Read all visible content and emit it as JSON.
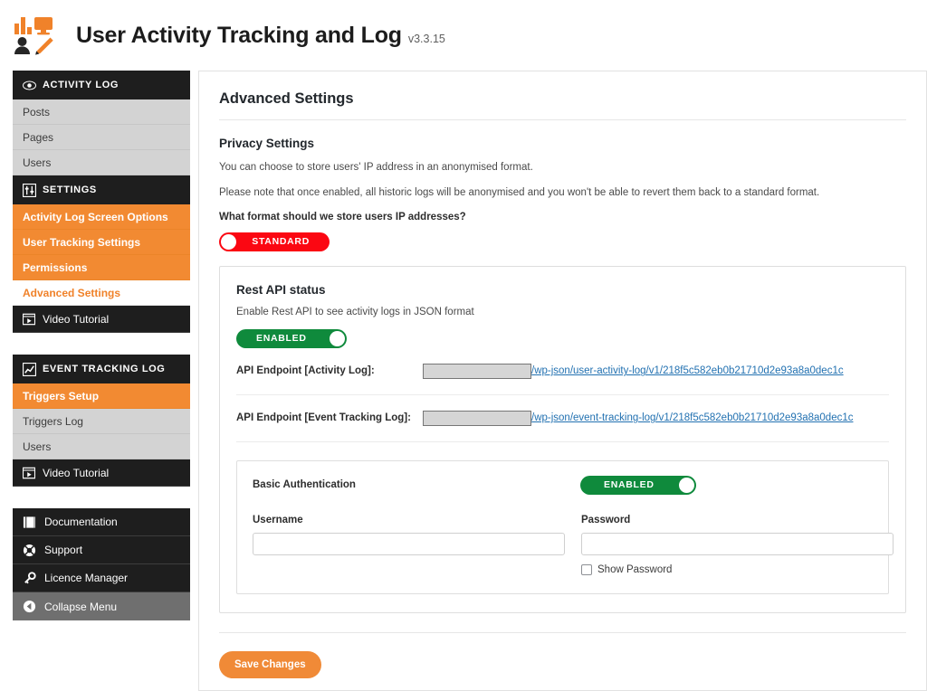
{
  "header": {
    "title": "User Activity Tracking and Log",
    "version": "v3.3.15",
    "logo_icon": "activity-tracking-logo-icon"
  },
  "sidebar": {
    "groups": [
      {
        "head": {
          "label": "ACTIVITY LOG",
          "icon": "eye-icon"
        },
        "items": [
          {
            "label": "Posts",
            "state": "normal"
          },
          {
            "label": "Pages",
            "state": "normal"
          },
          {
            "label": "Users",
            "state": "normal"
          }
        ]
      },
      {
        "head": {
          "label": "SETTINGS",
          "icon": "sliders-icon"
        },
        "items": [
          {
            "label": "Activity Log Screen Options",
            "state": "orange"
          },
          {
            "label": "User Tracking Settings",
            "state": "orange"
          },
          {
            "label": "Permissions",
            "state": "orange"
          },
          {
            "label": "Advanced Settings",
            "state": "current"
          }
        ],
        "foot": {
          "label": "Video Tutorial",
          "icon": "video-icon"
        }
      },
      {
        "head": {
          "label": "EVENT TRACKING LOG",
          "icon": "chart-line-icon"
        },
        "items": [
          {
            "label": "Triggers Setup",
            "state": "orange"
          },
          {
            "label": "Triggers Log",
            "state": "normal"
          },
          {
            "label": "Users",
            "state": "normal"
          }
        ],
        "foot": {
          "label": "Video Tutorial",
          "icon": "video-icon"
        }
      }
    ],
    "footer_items": [
      {
        "label": "Documentation",
        "icon": "book-icon"
      },
      {
        "label": "Support",
        "icon": "life-ring-icon"
      },
      {
        "label": "Licence Manager",
        "icon": "key-icon"
      },
      {
        "label": "Collapse Menu",
        "icon": "collapse-arrow-icon"
      }
    ]
  },
  "main": {
    "page_title": "Advanced Settings",
    "privacy": {
      "section_title": "Privacy Settings",
      "paragraph_1": "You can choose to store users' IP address in an anonymised format.",
      "paragraph_2": "Please note that once enabled, all historic logs will be anonymised and you won't be able to revert them back to a standard format.",
      "question": "What format should we store users IP addresses?",
      "toggle_label": "STANDARD",
      "toggle_state": "off",
      "toggle_color": "#fb0712"
    },
    "rest_api": {
      "title": "Rest API status",
      "subtitle": "Enable Rest API to see activity logs in JSON format",
      "toggle_label": "ENABLED",
      "toggle_state": "on",
      "toggle_color": "#0f8a3c",
      "endpoints": [
        {
          "label": "API Endpoint [Activity Log]:",
          "input_value": "",
          "url": "/wp-json/user-activity-log/v1/218f5c582eb0b21710d2e93a8a0dec1c"
        },
        {
          "label": "API Endpoint [Event Tracking Log]:",
          "input_value": "",
          "url": "/wp-json/event-tracking-log/v1/218f5c582eb0b21710d2e93a8a0dec1c"
        }
      ]
    },
    "basic_auth": {
      "label": "Basic Authentication",
      "toggle_label": "ENABLED",
      "toggle_state": "on",
      "username_label": "Username",
      "username_value": "",
      "password_label": "Password",
      "password_value": "",
      "show_password_label": "Show Password",
      "show_password_checked": false
    },
    "save_label": "Save Changes",
    "save_color": "#f08a37"
  }
}
